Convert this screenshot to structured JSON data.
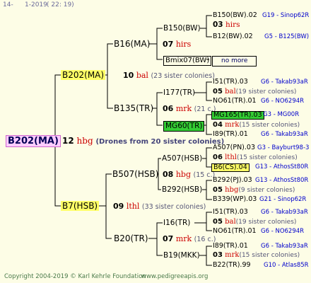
{
  "header": {
    "left": "14-",
    "date": "1-2019",
    "time": "( 22: 19)"
  },
  "root": {
    "name": "B202(MA)",
    "gen_num": "12",
    "race": "hbg",
    "note": "(Drones from 20 sister colonies)"
  },
  "mother": {
    "name": "B202(MA)",
    "gen_num": "10",
    "race": "bal",
    "note": "(23 sister colonies)"
  },
  "father": {
    "name": "B7(HSB)",
    "gen_num": "09",
    "race": "lthl",
    "note": "(33 sister colonies)"
  },
  "gm_b16": {
    "name": "B16(MA)",
    "gen_num": "07",
    "race": "hirs"
  },
  "gm_b135": {
    "name": "B135(TR)",
    "gen_num": "06",
    "race": "mrk",
    "note": "(21 c.)"
  },
  "gm_b507": {
    "name": "B507(HSB)",
    "gen_num": "08",
    "race": "hbg",
    "note": "(15 c.)"
  },
  "gm_b20": {
    "name": "B20(TR)",
    "gen_num": "07",
    "race": "mrk",
    "note": "(16 c.)"
  },
  "b150": {
    "name": "B150(BW)",
    "gen_num": "03",
    "race": "hirs"
  },
  "bmix07": {
    "name": "Bmix07(BW)",
    "note": "no more"
  },
  "i177": {
    "name": "I177(TR)",
    "gen_num": "05",
    "race": "bal",
    "note": "(19 sister colonies)"
  },
  "mg60": {
    "name": "MG60(TR)",
    "gen_num": "04",
    "race": "mrk",
    "note": "(15 sister colonies)"
  },
  "a507": {
    "name": "A507(HSB)",
    "gen_num": "06",
    "race": "lthl",
    "note": "(15 sister colonies)"
  },
  "b292": {
    "name": "B292(HSB)",
    "gen_num": "05",
    "race": "hbg",
    "note": "(9 sister colonies)"
  },
  "i16": {
    "name": "I16(TR)",
    "gen_num": "05",
    "race": "bal",
    "note": "(19 sister colonies)"
  },
  "b19": {
    "name": "B19(MKK)",
    "gen_num": "03",
    "race": "mrk",
    "note": "(15 sister colonies)"
  },
  "right": [
    {
      "name": "B150(BW).02",
      "ped": "G19 - Sinop62R"
    },
    {
      "name": "B12(BW).02",
      "ped": "G5 - B125(BW)"
    },
    {
      "name": "I51(TR).03",
      "ped": "G6 - Takab93aR"
    },
    {
      "name": "NO61(TR).01",
      "ped": "G6 - NO6294R"
    },
    {
      "name": "MG165(TR).03",
      "ped": "G3 - MG00R"
    },
    {
      "name": "I89(TR).01",
      "ped": "G6 - Takab93aR"
    },
    {
      "name": "A507(PN).03",
      "ped": "G3 - Bayburt98-3"
    },
    {
      "name": "B6(CS).04",
      "ped": "G13 - AthosSt80R"
    },
    {
      "name": "B292(PJ).03",
      "ped": "G13 - AthosSt80R"
    },
    {
      "name": "B339(WP).03",
      "ped": "G21 - Sinop62R"
    },
    {
      "name": "I51(TR).03",
      "ped": "G6 - Takab93aR"
    },
    {
      "name": "NO61(TR).01",
      "ped": "G6 - NO6294R"
    },
    {
      "name": "I89(TR).01",
      "ped": "G6 - Takab93aR"
    },
    {
      "name": "B22(TR).99",
      "ped": "G10 - Atlas85R"
    }
  ],
  "footer": {
    "copyright": "Copyright 2004-2019 © Karl Kehrle Foundation",
    "url": "www.pedigreeapis.org"
  },
  "colors": {
    "line": "#000000",
    "highlight_yellow": "#ffff66",
    "highlight_green": "#33cc33",
    "root_pink": "#ffccff",
    "race_red": "#cc0000"
  }
}
